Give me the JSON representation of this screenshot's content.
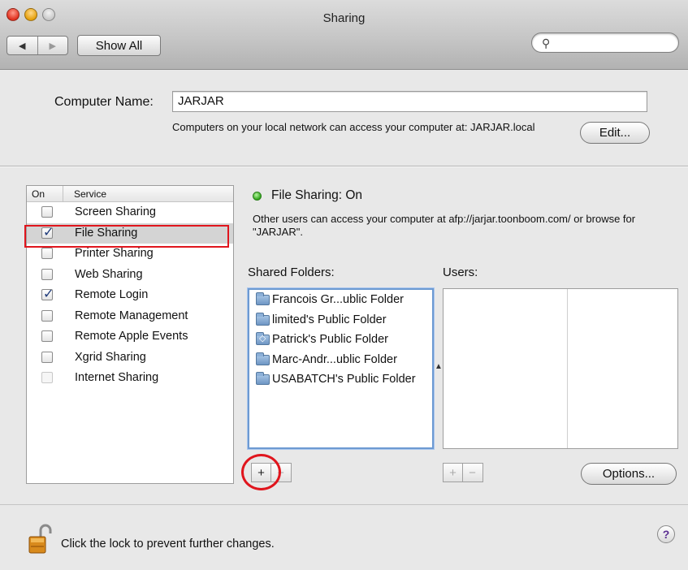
{
  "window": {
    "title": "Sharing"
  },
  "toolbar": {
    "back_glyph": "◀",
    "forward_glyph": "▶",
    "show_all_label": "Show All",
    "search_glyph": "⚲",
    "search_value": ""
  },
  "computer_name": {
    "label": "Computer Name:",
    "value": "JARJAR",
    "note": "Computers on your local network can access your computer at: JARJAR.local",
    "edit_label": "Edit..."
  },
  "services": {
    "header_on": "On",
    "header_service": "Service",
    "items": [
      {
        "name": "Screen Sharing",
        "checked": false,
        "enabled": true
      },
      {
        "name": "File Sharing",
        "checked": true,
        "enabled": true,
        "selected": true
      },
      {
        "name": "Printer Sharing",
        "checked": false,
        "enabled": true
      },
      {
        "name": "Web Sharing",
        "checked": false,
        "enabled": true
      },
      {
        "name": "Remote Login",
        "checked": true,
        "enabled": true
      },
      {
        "name": "Remote Management",
        "checked": false,
        "enabled": true
      },
      {
        "name": "Remote Apple Events",
        "checked": false,
        "enabled": true
      },
      {
        "name": "Xgrid Sharing",
        "checked": false,
        "enabled": true
      },
      {
        "name": "Internet Sharing",
        "checked": false,
        "enabled": false
      }
    ]
  },
  "status": {
    "title": "File Sharing: On",
    "color": "#2fa51a",
    "description": "Other users can access your computer at afp://jarjar.toonboom.com/ or browse for \"JARJAR\"."
  },
  "shared_folders": {
    "label": "Shared Folders:",
    "items": [
      {
        "name": "Francois Gr...ublic Folder",
        "icon": "folder-icon"
      },
      {
        "name": "limited's Public Folder",
        "icon": "folder-icon"
      },
      {
        "name": "Patrick's Public Folder",
        "icon": "public-folder-icon"
      },
      {
        "name": "Marc-Andr...ublic Folder",
        "icon": "folder-icon"
      },
      {
        "name": "USABATCH's Public Folder",
        "icon": "folder-icon"
      }
    ],
    "add_label": "+",
    "remove_label": "−"
  },
  "users": {
    "label": "Users:",
    "add_label": "+",
    "remove_label": "−"
  },
  "options_label": "Options...",
  "footer": {
    "lock_text": "Click the lock to prevent further changes.",
    "help_label": "?"
  },
  "annotations": {
    "highlight_color": "#e0151d"
  }
}
